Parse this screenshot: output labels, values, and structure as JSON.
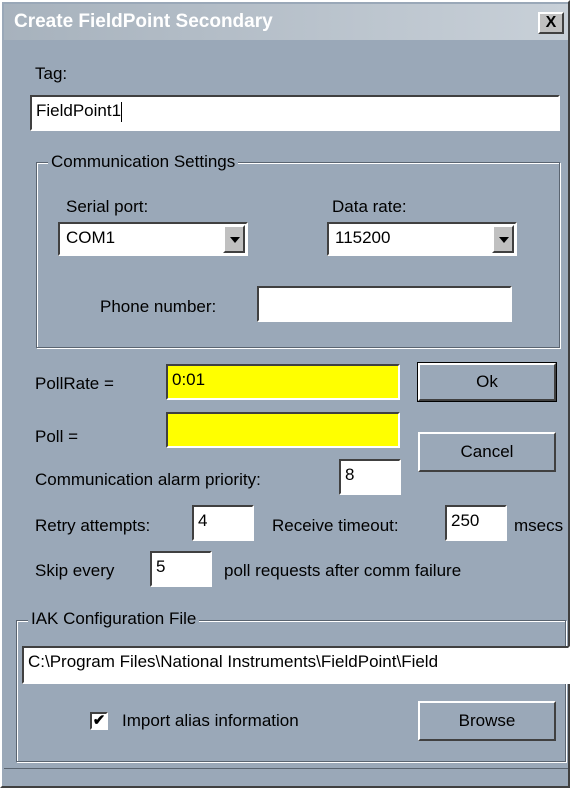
{
  "window": {
    "title": "Create FieldPoint Secondary",
    "close_label": "X"
  },
  "tag": {
    "label": "Tag:",
    "value": "FieldPoint1"
  },
  "comm": {
    "legend": "Communication Settings",
    "serial_label": "Serial port:",
    "serial_value": "COM1",
    "rate_label": "Data rate:",
    "rate_value": "115200",
    "phone_label": "Phone number:",
    "phone_value": ""
  },
  "poll": {
    "pollrate_label": "PollRate =",
    "pollrate_value": "0:01",
    "poll_label": "Poll =",
    "poll_value": ""
  },
  "buttons": {
    "ok": "Ok",
    "cancel": "Cancel",
    "browse": "Browse"
  },
  "alarm": {
    "label": "Communication alarm priority:",
    "value": "8"
  },
  "retry": {
    "label": "Retry attempts:",
    "value": "4",
    "timeout_label": "Receive timeout:",
    "timeout_value": "250",
    "timeout_unit": "msecs"
  },
  "skip": {
    "label": "Skip every",
    "value": "5",
    "suffix": "poll requests after comm failure"
  },
  "iak": {
    "legend": "IAK Configuration File",
    "path": "C:\\Program Files\\National Instruments\\FieldPoint\\Field",
    "import_label": "Import alias information",
    "import_checked": "✔"
  },
  "colors": {
    "dialog_bg": "#9aa8b8",
    "highlight_field": "#ffff00"
  }
}
